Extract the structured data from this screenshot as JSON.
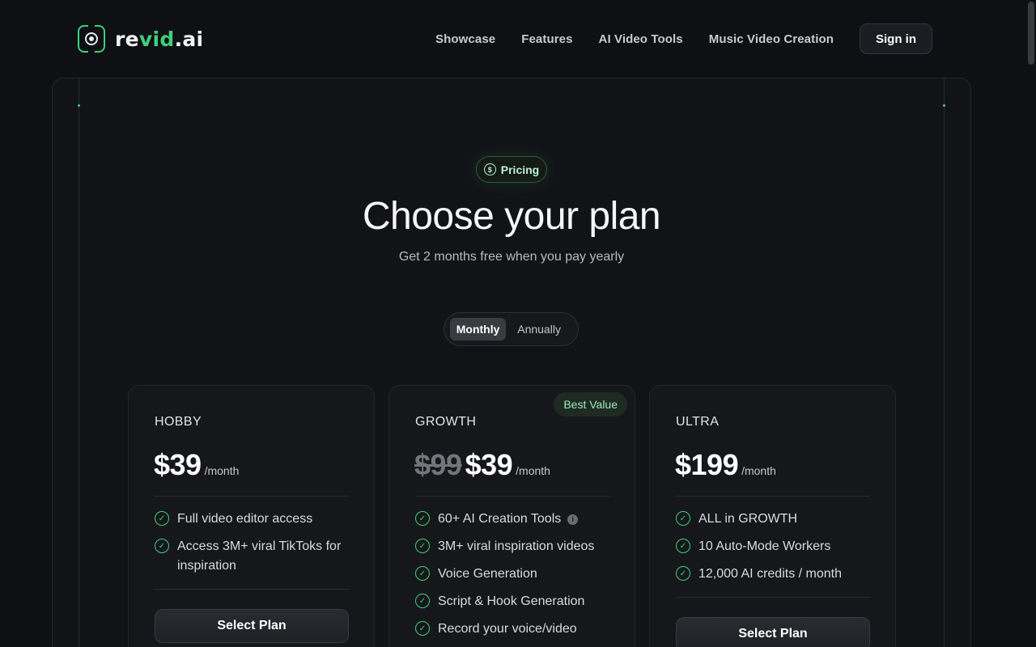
{
  "header": {
    "logo": {
      "text_main": "re",
      "text_accent": "vid",
      "text_suffix": ".ai"
    },
    "nav": [
      {
        "label": "Showcase"
      },
      {
        "label": "Features"
      },
      {
        "label": "AI Video Tools"
      },
      {
        "label": "Music Video Creation"
      }
    ],
    "sign_in_label": "Sign in"
  },
  "hero": {
    "pill_icon": "$",
    "pill_label": "Pricing",
    "title": "Choose your plan",
    "subtitle": "Get 2 months free when you pay yearly"
  },
  "billing_toggle": {
    "options": [
      {
        "label": "Monthly",
        "active": true
      },
      {
        "label": "Annually",
        "active": false
      }
    ]
  },
  "plans": [
    {
      "name": "HOBBY",
      "price": "$39",
      "period": "/month",
      "features": [
        "Full video editor access",
        "Access 3M+ viral TikToks for inspiration"
      ],
      "button_label": "Select Plan"
    },
    {
      "name": "GROWTH",
      "badge": "Best Value",
      "old_price": "$99",
      "price": "$39",
      "period": "/month",
      "features": [
        "60+ AI Creation Tools",
        "3M+ viral inspiration videos",
        "Voice Generation",
        "Script & Hook Generation",
        "Record your voice/video"
      ],
      "info_icon": "i"
    },
    {
      "name": "ULTRA",
      "price": "$199",
      "period": "/month",
      "features": [
        "ALL in GROWTH",
        "10 Auto-Mode Workers",
        "12,000 AI credits / month"
      ],
      "button_label": "Select Plan"
    }
  ],
  "icons": {
    "check": "✓",
    "accent_color": "#3fcf7a"
  }
}
